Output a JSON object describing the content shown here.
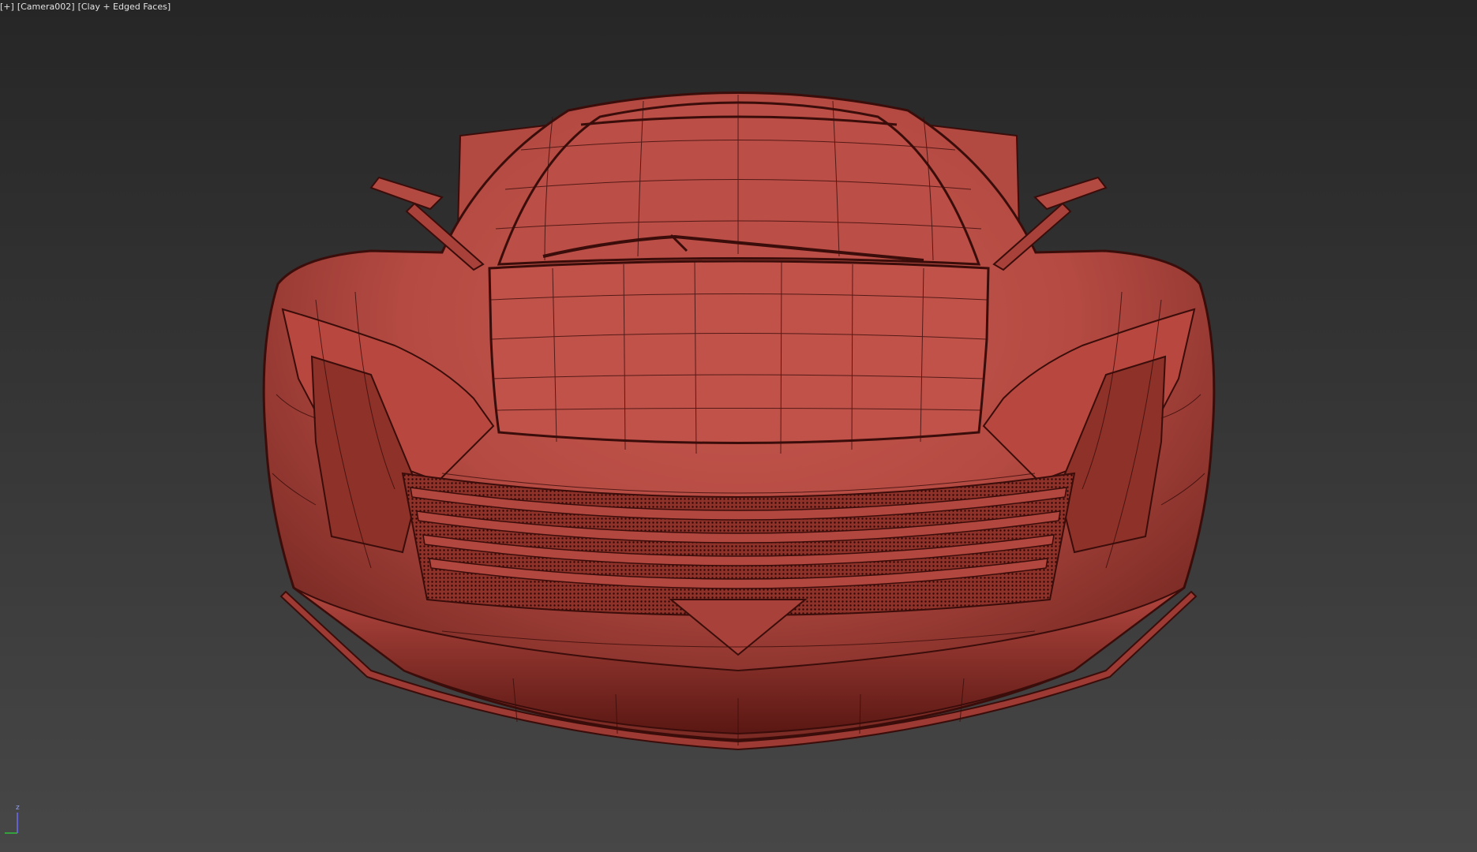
{
  "viewport": {
    "menu_label": "[+]",
    "camera_label": "[Camera002]",
    "shading_label": "[Clay + Edged Faces]"
  },
  "gizmo": {
    "z_label": "z"
  },
  "colors": {
    "clay": "#c0524a",
    "clay_dark": "#6d1f1b",
    "edge": "#3a0d0a",
    "background_top": "#262626",
    "background_bottom": "#474747"
  }
}
